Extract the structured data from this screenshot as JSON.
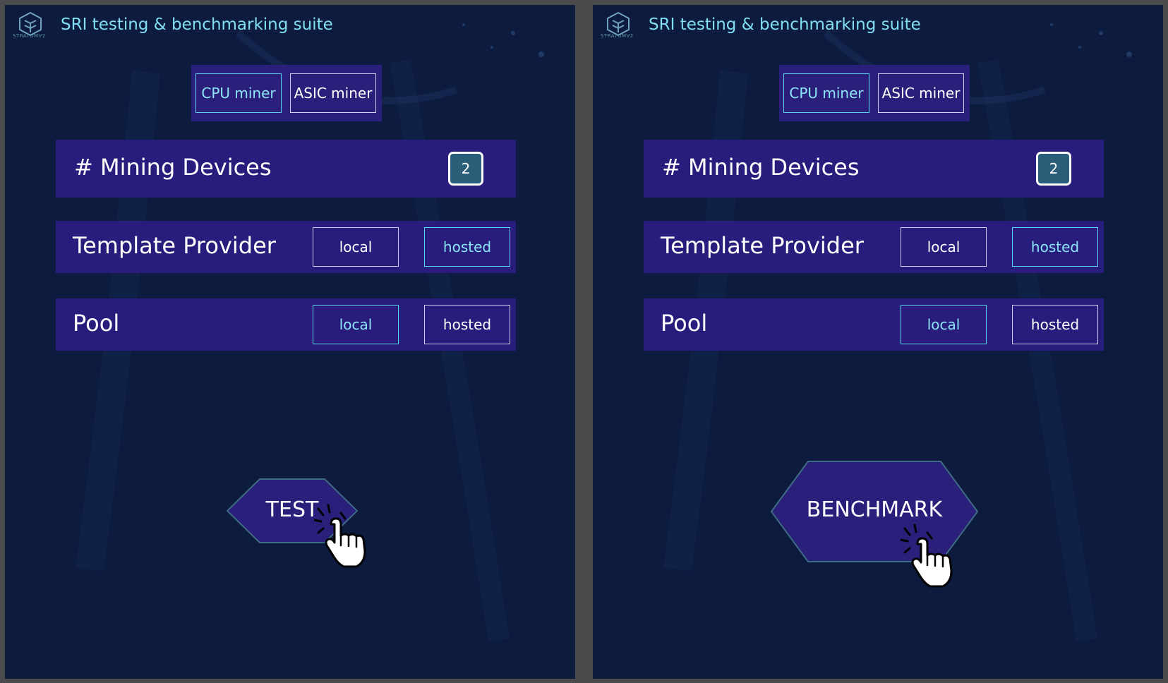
{
  "panels": [
    {
      "logo_text": "STRATUMV2",
      "title": "SRI testing & benchmarking suite",
      "miner_types": [
        {
          "label": "CPU miner",
          "selected": true
        },
        {
          "label": "ASIC miner",
          "selected": false
        }
      ],
      "mining_devices": {
        "label": "# Mining Devices",
        "value": "2"
      },
      "template_provider": {
        "label": "Template Provider",
        "options": [
          {
            "label": "local",
            "selected": false
          },
          {
            "label": "hosted",
            "selected": true
          }
        ]
      },
      "pool": {
        "label": "Pool",
        "options": [
          {
            "label": "local",
            "selected": true
          },
          {
            "label": "hosted",
            "selected": false
          }
        ]
      },
      "action": {
        "label": "TEST"
      },
      "cursor_icon": "hand-pointer-click-icon"
    },
    {
      "logo_text": "STRATUMV2",
      "title": "SRI testing & benchmarking suite",
      "miner_types": [
        {
          "label": "CPU miner",
          "selected": true
        },
        {
          "label": "ASIC miner",
          "selected": false
        }
      ],
      "mining_devices": {
        "label": "# Mining Devices",
        "value": "2"
      },
      "template_provider": {
        "label": "Template Provider",
        "options": [
          {
            "label": "local",
            "selected": false
          },
          {
            "label": "hosted",
            "selected": true
          }
        ]
      },
      "pool": {
        "label": "Pool",
        "options": [
          {
            "label": "local",
            "selected": true
          },
          {
            "label": "hosted",
            "selected": false
          }
        ]
      },
      "action": {
        "label": "BENCHMARK"
      },
      "cursor_icon": "hand-pointer-click-icon"
    }
  ],
  "colors": {
    "background": "#0d1b3f",
    "row_background": "#281d7c",
    "accent": "#82dff3",
    "badge": "#2a5d77"
  }
}
